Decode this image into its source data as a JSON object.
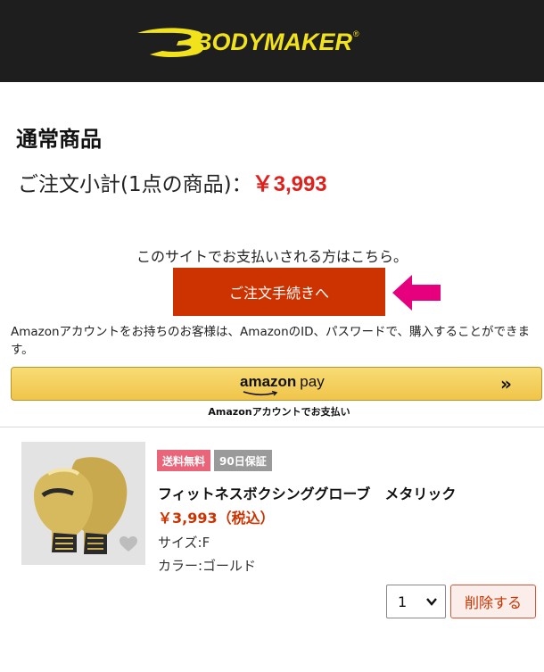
{
  "header": {
    "brand": "BODYMAKER",
    "registered_mark": "®",
    "brand_color": "#f2e21b",
    "background": "#1e1e1e"
  },
  "cart": {
    "section_title": "通常商品",
    "subtotal_label": "ご注文小計(1点の商品)：",
    "subtotal_price": "￥3,993",
    "price_color": "#e0201c"
  },
  "checkout": {
    "note": "このサイトでお支払いされる方はこちら。",
    "button_label": "ご注文手続きへ",
    "button_color": "#cc3300",
    "arrow_color": "#e6007e"
  },
  "amazon": {
    "note": "Amazonアカウントをお持ちのお客様は、AmazonのID、パスワードで、購入することができます。",
    "logo_word": "amazon",
    "logo_suffix": "pay",
    "chevron": "»",
    "sub_label": "Amazonアカウントでお支払い"
  },
  "product": {
    "badges": [
      "送料無料",
      "90日保証"
    ],
    "name": "フィットネスボクシンググローブ　メタリック",
    "price": "￥3,993（税込）",
    "size": "サイズ:F",
    "color": "カラー:ゴールド",
    "image_icon": "boxing-gloves-image",
    "favorite_icon": "heart-icon"
  },
  "controls": {
    "quantity": "1",
    "delete_label": "削除する"
  }
}
